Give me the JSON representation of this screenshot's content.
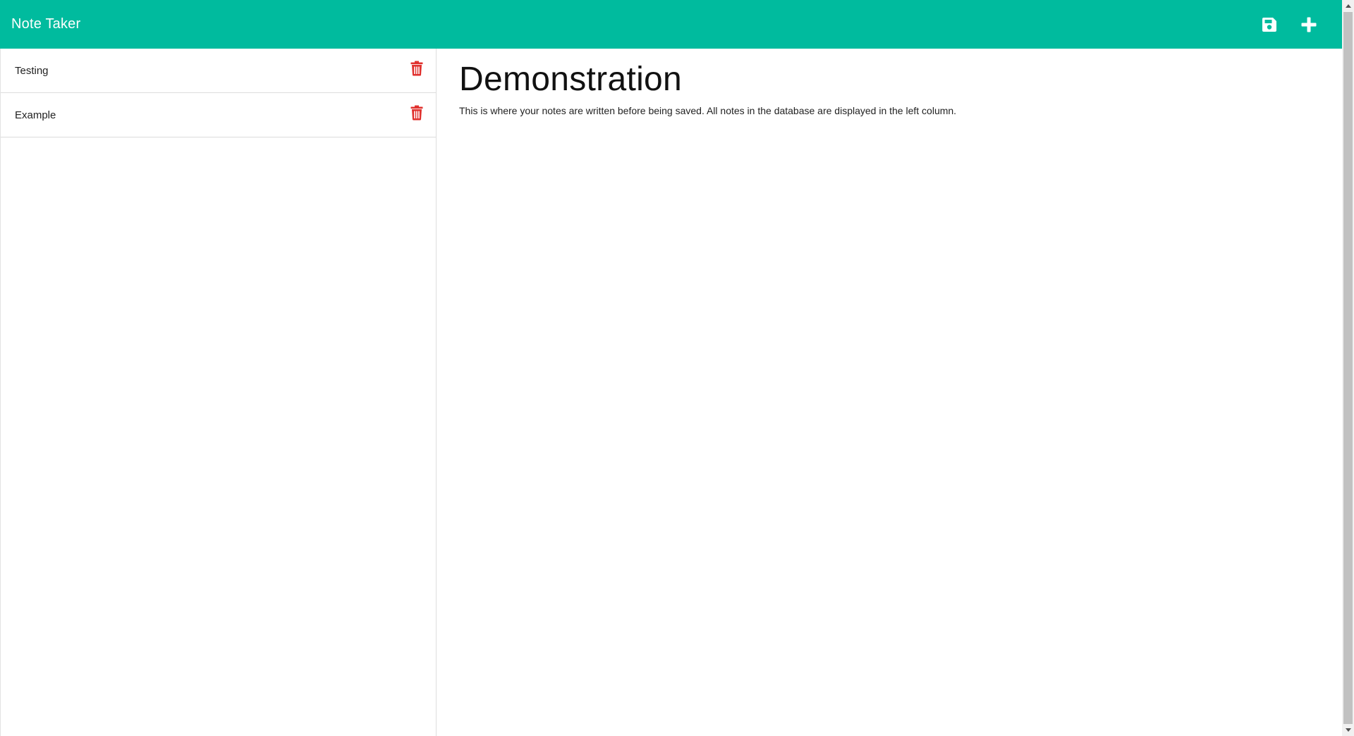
{
  "app": {
    "title": "Note Taker",
    "colors": {
      "navbar": "#00bb9e",
      "trash": "#e0312e"
    }
  },
  "toolbar": {
    "save_icon": "save-icon",
    "new_icon": "plus-icon"
  },
  "sidebar": {
    "notes": [
      {
        "title": "Testing",
        "icon": "trash-icon"
      },
      {
        "title": "Example",
        "icon": "trash-icon"
      }
    ]
  },
  "editor": {
    "title": "Demonstration",
    "text": "This is where your notes are written before being saved. All notes in the database are displayed in the left column."
  }
}
